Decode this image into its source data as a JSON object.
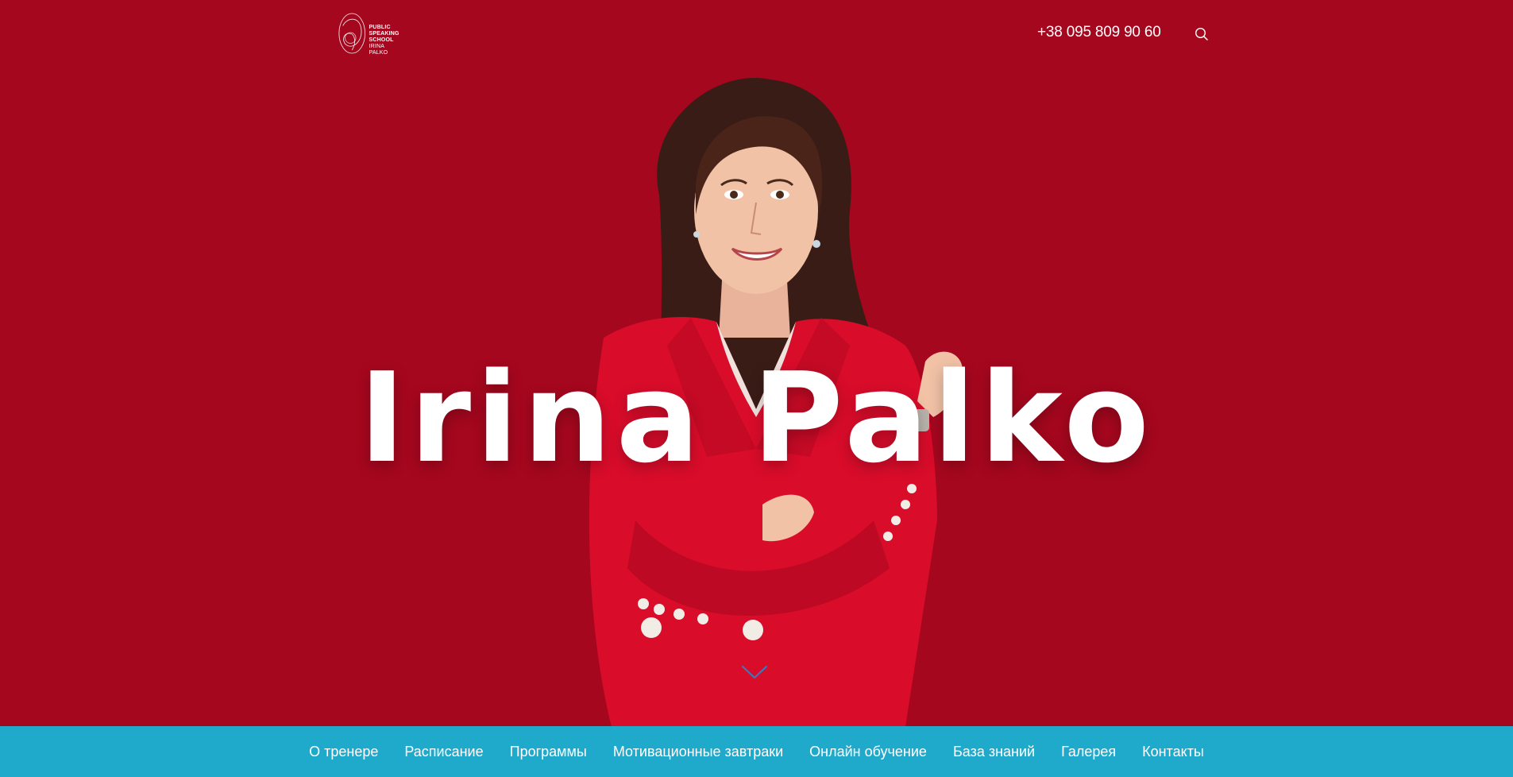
{
  "header": {
    "logo": {
      "line1": "PUBLIC",
      "line2": "SPEAKING",
      "line3": "SCHOOL",
      "line4": "IRINA PALKO"
    },
    "phone": "+38 095 809 90 60",
    "search_icon": "search-icon"
  },
  "hero": {
    "title": "Irina Palko",
    "scroll_icon": "chevron-down-icon"
  },
  "nav": {
    "items": [
      {
        "label": "О тренере"
      },
      {
        "label": "Расписание"
      },
      {
        "label": "Программы"
      },
      {
        "label": "Мотивационные завтраки"
      },
      {
        "label": "Онлайн обучение"
      },
      {
        "label": "База знаний"
      },
      {
        "label": "Галерея"
      },
      {
        "label": "Контакты"
      }
    ]
  },
  "colors": {
    "background": "#a5071e",
    "nav_background": "#1fa9cb",
    "text": "#ffffff",
    "jacket": "#d90c2a",
    "scroll_chevron": "#3b78c2"
  }
}
